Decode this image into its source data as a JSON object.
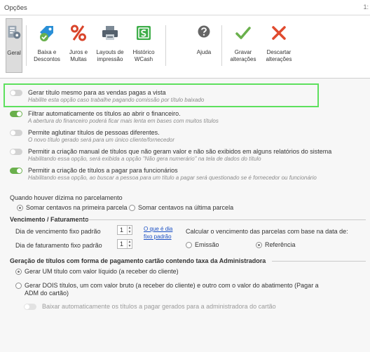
{
  "window": {
    "title": "Opções",
    "close_glyph": "1:"
  },
  "ribbon": [
    {
      "id": "geral",
      "line1": "Geral",
      "line2": "",
      "icon": "general-settings-icon",
      "selected": true
    },
    {
      "id": "baixa",
      "line1": "Baixa e",
      "line2": "Descontos",
      "icon": "discount-tag-icon"
    },
    {
      "id": "juros",
      "line1": "Juros e",
      "line2": "Multas",
      "icon": "percent-icon"
    },
    {
      "id": "layouts",
      "line1": "Layouts de",
      "line2": "impressão",
      "icon": "printer-icon"
    },
    {
      "id": "historico",
      "line1": "Histórico",
      "line2": "WCash",
      "icon": "wcash-icon"
    },
    {
      "id": "ajuda",
      "line1": "Ajuda",
      "line2": "",
      "icon": "help-icon"
    },
    {
      "id": "gravar",
      "line1": "Gravar",
      "line2": "alterações",
      "icon": "checkmark-icon"
    },
    {
      "id": "descartar",
      "line1": "Descartar",
      "line2": "alterações",
      "icon": "close-x-icon"
    }
  ],
  "colors": {
    "accent_green": "#6ab04c",
    "highlight": "#5ee05e",
    "discard_red": "#e04a2e",
    "help_gray": "#666666",
    "link_blue": "#1a4fc4"
  },
  "options": [
    {
      "label": "Gerar título mesmo para as vendas pagas a vista",
      "desc": "Habilite esta opção caso trabalhe pagando comissão por título baixado",
      "on": false
    },
    {
      "label": "Filtrar automaticamente os títulos ao abrir o financeiro.",
      "desc": "A abertura do financeiro poderá ficar mais lenta em bases com muitos títulos",
      "on": true
    },
    {
      "label": "Permite aglutinar títulos de pessoas diferentes.",
      "desc": "O novo título gerado será para um único cliente/fornecedor",
      "on": false
    },
    {
      "label": "Permitir a criação manual de títulos que não geram valor e não são exibidos em alguns relatórios do sistema",
      "desc": "Habilitando essa opção, será exibida a opção \"Não gera numerário\" na tela de dados do título",
      "on": false
    },
    {
      "label": "Permitir a criação de títulos a pagar para funcionários",
      "desc": "Habilitando essa opção, ao buscar a pessoa para um título a pagar será questionado se é fornecedor ou funcionário",
      "on": true
    }
  ],
  "dizima": {
    "label": "Quando houver dízima no parcelamento",
    "first": "Somar centavos na primeira parcela",
    "last": "Somar centavos na última parcela",
    "selected": "first"
  },
  "vencimento": {
    "title": "Vencimento / Faturamento",
    "dia_venc_label": "Dia de vencimento fixo padrão",
    "dia_venc_value": "1",
    "dia_fat_label": "Dia de faturamento fixo padrão",
    "dia_fat_value": "1",
    "link_line1": "O que é dia",
    "link_line2": "fixo padrão",
    "calc_label": "Calcular o vencimento das parcelas com base na data de:",
    "emissao": "Emissão",
    "referencia": "Referência",
    "selected": "referencia"
  },
  "cartao": {
    "title": "Geração de títulos com forma de pagamento cartão contendo taxa da Administradora",
    "opt1": "Gerar UM título com valor líquido (a receber do cliente)",
    "opt2_line1": "Gerar DOIS títulos, um com valor bruto (a receber do cliente) e outro com o valor do abatimento (Pagar a",
    "opt2_line2": "ADM do cartão)",
    "selected": "opt1",
    "auto_label": "Baixar automaticamente os títulos a pagar gerados para a administradora do cartão"
  }
}
